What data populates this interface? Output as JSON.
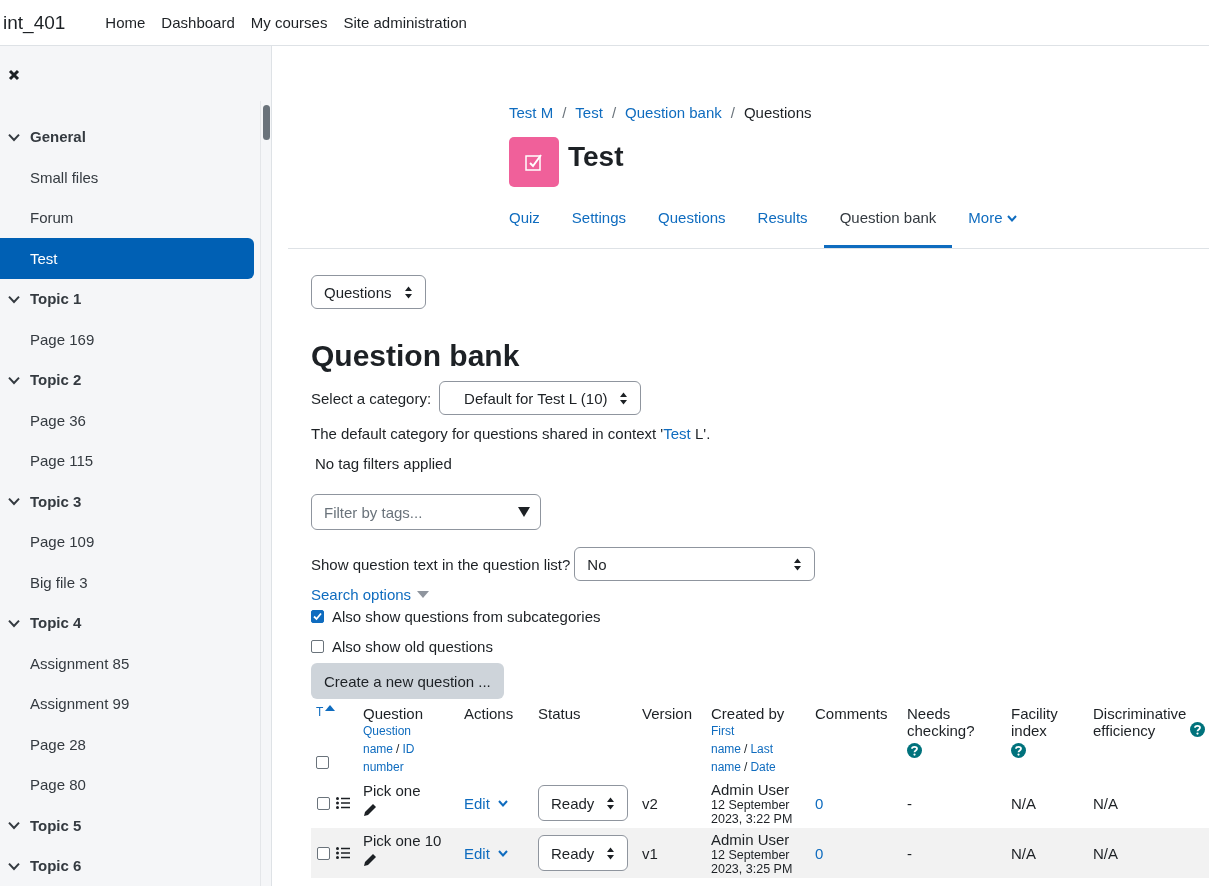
{
  "navbar": {
    "site_name": "int_401",
    "links": [
      "Home",
      "Dashboard",
      "My courses",
      "Site administration"
    ]
  },
  "drawer": {
    "sections": [
      {
        "title": "General",
        "expanded": true,
        "items": [
          {
            "label": "Small files",
            "selected": false
          },
          {
            "label": "Forum",
            "selected": false
          },
          {
            "label": "Test",
            "selected": true
          }
        ]
      },
      {
        "title": "Topic 1",
        "expanded": true,
        "items": [
          {
            "label": "Page 169",
            "selected": false
          }
        ]
      },
      {
        "title": "Topic 2",
        "expanded": true,
        "items": [
          {
            "label": "Page 36",
            "selected": false
          },
          {
            "label": "Page 115",
            "selected": false
          }
        ]
      },
      {
        "title": "Topic 3",
        "expanded": true,
        "items": [
          {
            "label": "Page 109",
            "selected": false
          },
          {
            "label": "Big file 3",
            "selected": false
          }
        ]
      },
      {
        "title": "Topic 4",
        "expanded": true,
        "items": [
          {
            "label": "Assignment 85",
            "selected": false
          },
          {
            "label": "Assignment 99",
            "selected": false
          },
          {
            "label": "Page 28",
            "selected": false
          },
          {
            "label": "Page 80",
            "selected": false
          }
        ]
      },
      {
        "title": "Topic 5",
        "expanded": true
      },
      {
        "title": "Topic 6",
        "expanded": true
      }
    ]
  },
  "header": {
    "breadcrumb": [
      {
        "kind": "link",
        "label": "Test M"
      },
      {
        "kind": "separator",
        "label": "/"
      },
      {
        "kind": "link",
        "label": "Test"
      },
      {
        "kind": "separator",
        "label": "/"
      },
      {
        "kind": "link",
        "label": "Question bank"
      },
      {
        "kind": "separator",
        "label": "/"
      },
      {
        "kind": "current",
        "label": "Questions"
      }
    ],
    "title": "Test",
    "tabs": [
      {
        "label": "Quiz",
        "selected": false
      },
      {
        "label": "Settings",
        "selected": false
      },
      {
        "label": "Questions",
        "selected": false
      },
      {
        "label": "Results",
        "selected": false
      },
      {
        "label": "Question bank",
        "selected": true
      },
      {
        "label": "More",
        "selected": false,
        "menu": true
      }
    ]
  },
  "page_select": {
    "value": "Questions"
  },
  "heading": "Question bank",
  "category": {
    "label": "Select a category:",
    "value": "Default for Test L (10)"
  },
  "default_note": {
    "before": "The default category for questions shared in context '",
    "link": "Test",
    "after": " L'."
  },
  "tag_status": "No tag filters applied",
  "tag_filter": {
    "placeholder": "Filter by tags..."
  },
  "show_text": {
    "label": "Show question text in the question list?",
    "value": "No"
  },
  "search_options": "Search options",
  "options": [
    {
      "label": "Also show questions from subcategories",
      "checked": true
    },
    {
      "label": "Also show old questions",
      "checked": false
    }
  ],
  "create_button": "Create a new question ...",
  "table": {
    "columns": [
      {
        "label": "T",
        "sort_ascending": true
      },
      {
        "label": "Question",
        "sublinks": [
          {
            "kind": "link",
            "label": "Question name"
          },
          {
            "kind": "separator",
            "label": "/"
          },
          {
            "kind": "link",
            "label": "ID number"
          }
        ]
      },
      {
        "label": "Actions"
      },
      {
        "label": "Status"
      },
      {
        "label": "Version"
      },
      {
        "label": "Created by",
        "sublinks": [
          {
            "kind": "link",
            "label": "First name"
          },
          {
            "kind": "separator",
            "label": "/"
          },
          {
            "kind": "link",
            "label": "Last name"
          },
          {
            "kind": "separator",
            "label": "/"
          },
          {
            "kind": "link",
            "label": "Date"
          }
        ]
      },
      {
        "label": "Comments"
      },
      {
        "label": "Needs checking?",
        "help": true
      },
      {
        "label": "Facility index",
        "help": true
      },
      {
        "label": "Discriminative efficiency",
        "help": true
      }
    ],
    "all_checked": false,
    "rows": [
      {
        "checked": false,
        "name": "Pick one",
        "action": "Edit",
        "status": "Ready",
        "version": "v2",
        "creator": "Admin User",
        "date": "12 September 2023, 3:22 PM",
        "comments": "0",
        "needs_checking": "-",
        "facility": "N/A",
        "discrimination": "N/A"
      },
      {
        "checked": false,
        "name": "Pick one 10",
        "action": "Edit",
        "status": "Ready",
        "version": "v1",
        "creator": "Admin User",
        "date": "12 September 2023, 3:25 PM",
        "comments": "0",
        "needs_checking": "-",
        "facility": "N/A",
        "discrimination": "N/A"
      }
    ]
  }
}
